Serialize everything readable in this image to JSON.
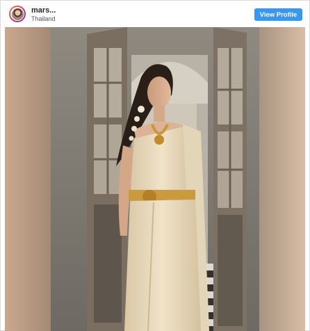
{
  "post": {
    "username": "mars...",
    "location": "Thailand",
    "view_profile_label": "View Profile"
  },
  "icons": {
    "avatar": "profile-avatar"
  },
  "colors": {
    "button": "#3897f0",
    "border": "#dbdbdb"
  }
}
